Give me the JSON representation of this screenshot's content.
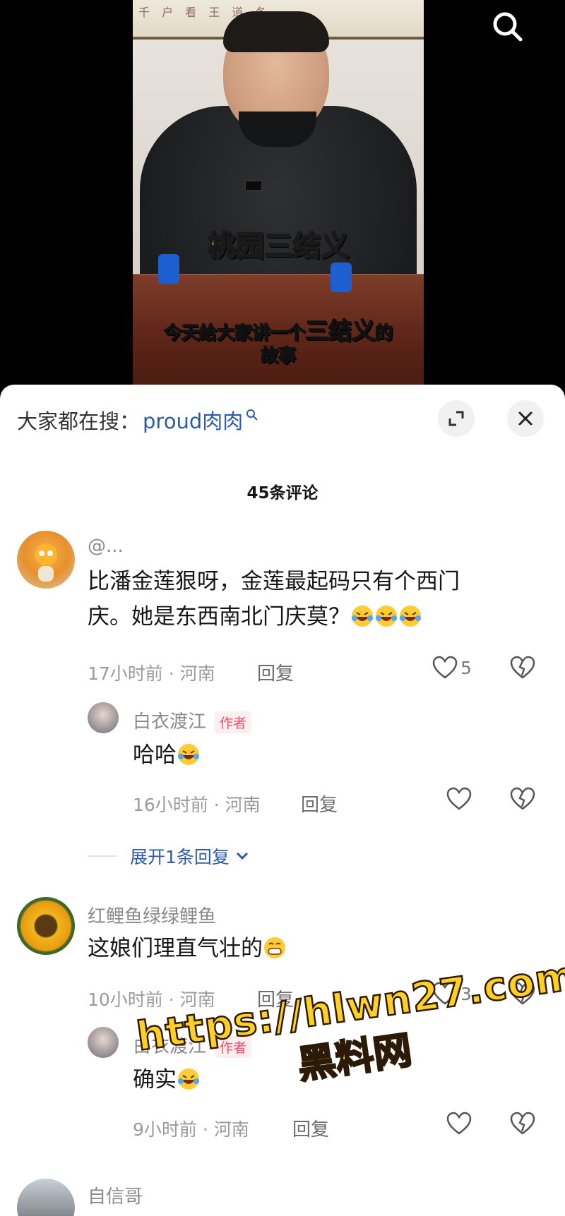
{
  "video": {
    "calligraphy": "千 户 看 王 道 冬",
    "title_caption": "桃园三结义",
    "subtitle_pre": "今天给大家讲一个",
    "subtitle_highlight": "三结义",
    "subtitle_post": "的",
    "subtitle_line2": "故事",
    "search_icon": "search-icon"
  },
  "sheet": {
    "search_prefix": "大家都在搜：",
    "search_term": "proud肉肉",
    "expand_icon": "expand-icon",
    "close_icon": "close-icon",
    "comment_count": "45条评论"
  },
  "comments": [
    {
      "name": "@...",
      "text_line1": "比潘金莲狠呀，金莲最起码只有个西门",
      "text_line2": "庆。她是东西南北门庆莫？",
      "time_loc": "17小时前 · 河南",
      "reply_label": "回复",
      "likes": "5",
      "reply": {
        "name": "白衣渡江",
        "author_tag": "作者",
        "text": "哈哈",
        "time_loc": "16小时前 · 河南",
        "reply_label": "回复"
      },
      "expand_label": "展开1条回复"
    },
    {
      "name": "红鲤鱼绿绿鲤鱼",
      "text": "这娘们理直气壮的",
      "time_loc": "10小时前 · 河南",
      "reply_label": "回复",
      "likes": "3",
      "reply": {
        "name": "白衣渡江",
        "author_tag": "作者",
        "text": "确实",
        "time_loc": "9小时前 · 河南",
        "reply_label": "回复"
      }
    },
    {
      "name": "自信哥"
    }
  ],
  "watermark": {
    "url": "https://hlwn27.com",
    "name": "黑料网"
  },
  "colors": {
    "link_blue": "#2c5aa8",
    "author_pink": "#f24d6a",
    "caption_yellow": "#ffd700"
  }
}
